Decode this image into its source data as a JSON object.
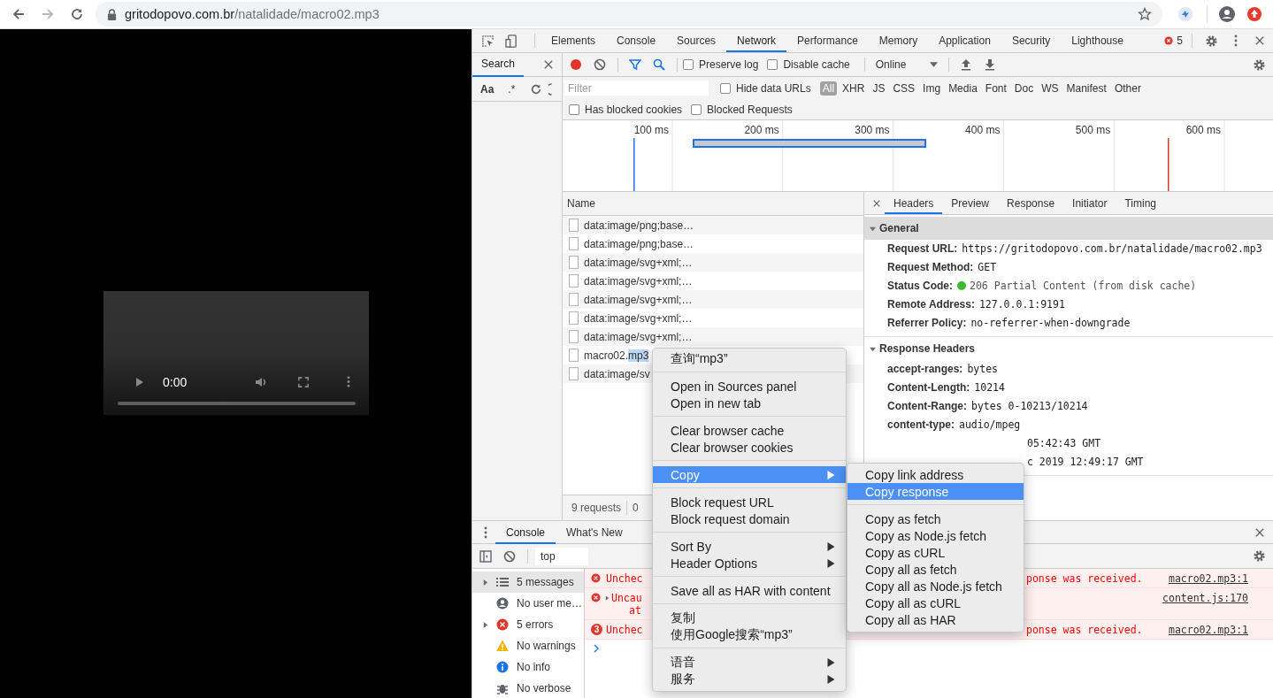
{
  "browser": {
    "url_host": "gritodopovo.com.br",
    "url_path": "/natalidade/macro02.mp3"
  },
  "player": {
    "time": "0:00"
  },
  "devtools": {
    "tabs": [
      {
        "label": "Elements",
        "selected": false
      },
      {
        "label": "Console",
        "selected": false
      },
      {
        "label": "Sources",
        "selected": false
      },
      {
        "label": "Network",
        "selected": true
      },
      {
        "label": "Performance",
        "selected": false
      },
      {
        "label": "Memory",
        "selected": false
      },
      {
        "label": "Application",
        "selected": false
      },
      {
        "label": "Security",
        "selected": false
      },
      {
        "label": "Lighthouse",
        "selected": false
      }
    ],
    "error_count": "5",
    "search_panel": {
      "tab": "Search",
      "options": [
        "Aa",
        ".*"
      ]
    },
    "toolbar": {
      "recording": true,
      "checkboxes": [
        {
          "label": "Preserve log",
          "checked": false
        },
        {
          "label": "Disable cache",
          "checked": false
        }
      ],
      "throttling": "Online"
    },
    "filter": {
      "placeholder": "Filter",
      "hide_data_urls": {
        "label": "Hide data URLs",
        "checked": false
      },
      "types": [
        {
          "label": "All",
          "selected": true
        },
        {
          "label": "XHR",
          "selected": false
        },
        {
          "label": "JS",
          "selected": false
        },
        {
          "label": "CSS",
          "selected": false
        },
        {
          "label": "Img",
          "selected": false
        },
        {
          "label": "Media",
          "selected": false
        },
        {
          "label": "Font",
          "selected": false
        },
        {
          "label": "Doc",
          "selected": false
        },
        {
          "label": "WS",
          "selected": false
        },
        {
          "label": "Manifest",
          "selected": false
        },
        {
          "label": "Other",
          "selected": false
        }
      ],
      "extra": [
        {
          "label": "Has blocked cookies",
          "checked": false
        },
        {
          "label": "Blocked Requests",
          "checked": false
        }
      ]
    },
    "overview": {
      "ticks": [
        "100 ms",
        "200 ms",
        "300 ms",
        "400 ms",
        "500 ms",
        "600 ms"
      ]
    },
    "requests": {
      "column": "Name",
      "rows": [
        {
          "name": "data:image/png;base…"
        },
        {
          "name": "data:image/png;base…"
        },
        {
          "name": "data:image/svg+xml;…"
        },
        {
          "name": "data:image/svg+xml;…"
        },
        {
          "name": "data:image/svg+xml;…"
        },
        {
          "name": "data:image/svg+xml;…"
        },
        {
          "name": "data:image/svg+xml;…"
        },
        {
          "name": "macro02.",
          "highlight": "mp3"
        },
        {
          "name": "data:image/sv"
        }
      ],
      "status": [
        "9 requests",
        "0"
      ]
    },
    "detail_tabs": [
      {
        "label": "Headers",
        "selected": true
      },
      {
        "label": "Preview",
        "selected": false
      },
      {
        "label": "Response",
        "selected": false
      },
      {
        "label": "Initiator",
        "selected": false
      },
      {
        "label": "Timing",
        "selected": false
      }
    ],
    "sections": [
      {
        "title": "General",
        "expanded": true,
        "rows": [
          {
            "kind": "pair",
            "key": "Request URL:",
            "value": "https://gritodopovo.com.br/natalidade/macro02.mp3"
          },
          {
            "kind": "pair",
            "key": "Request Method:",
            "value": "GET"
          },
          {
            "kind": "pair",
            "key": "Status Code:",
            "value": "206 Partial Content (from disk cache)",
            "color": "#3cba2e"
          },
          {
            "kind": "pair",
            "key": "Remote Address:",
            "value": "127.0.0.1:9191"
          },
          {
            "kind": "pair",
            "key": "Referrer Policy:",
            "value": "no-referrer-when-downgrade"
          }
        ]
      },
      {
        "title": "Response Headers",
        "expanded": true,
        "rows": [
          {
            "kind": "pair",
            "key": "accept-ranges:",
            "value": "bytes"
          },
          {
            "kind": "pair",
            "key": "Content-Length:",
            "value": "10214"
          },
          {
            "kind": "pair",
            "key": "Content-Range:",
            "value": "bytes 0-10213/10214"
          },
          {
            "kind": "pair",
            "key": "content-type:",
            "value": "audio/mpeg"
          },
          {
            "kind": "fragment",
            "value": "05:42:43 GMT"
          },
          {
            "kind": "fragment",
            "value": "c 2019 12:49:17 GMT"
          }
        ]
      }
    ],
    "drawer": {
      "tabs": [
        {
          "label": "Console",
          "selected": true
        },
        {
          "label": "What's New",
          "selected": false
        }
      ],
      "context": "top",
      "sidebar": [
        {
          "kind": "messages",
          "label": "5 messages",
          "expandable": true,
          "selected": true
        },
        {
          "kind": "user",
          "label": "No user me…",
          "expandable": false,
          "selected": false
        },
        {
          "kind": "errors",
          "label": "5 errors",
          "expandable": true,
          "selected": false
        },
        {
          "kind": "warnings",
          "label": "No warnings",
          "expandable": false,
          "selected": false
        },
        {
          "kind": "info",
          "label": "No info",
          "expandable": false,
          "selected": false
        },
        {
          "kind": "verbose",
          "label": "No verbose",
          "expandable": false,
          "selected": false
        }
      ],
      "messages": [
        {
          "kind": "error",
          "start": "Unchec",
          "end": "ponse was received.",
          "source": "macro02.mp3:1"
        },
        {
          "kind": "uncaught",
          "start": "Uncau",
          "second": "at",
          "source": "content.js:170"
        },
        {
          "kind": "repeat",
          "count": "3",
          "start": "Unchec",
          "end": "ponse was received.",
          "source": "macro02.mp3:1"
        }
      ]
    }
  },
  "context_menu": {
    "groups": [
      [
        {
          "label": "查询“mp3”",
          "submenu": false,
          "selected": false
        }
      ],
      [
        {
          "label": "Open in Sources panel",
          "submenu": false,
          "selected": false
        },
        {
          "label": "Open in new tab",
          "submenu": false,
          "selected": false
        }
      ],
      [
        {
          "label": "Clear browser cache",
          "submenu": false,
          "selected": false
        },
        {
          "label": "Clear browser cookies",
          "submenu": false,
          "selected": false
        }
      ],
      [
        {
          "label": "Copy",
          "submenu": true,
          "selected": true
        }
      ],
      [
        {
          "label": "Block request URL",
          "submenu": false,
          "selected": false
        },
        {
          "label": "Block request domain",
          "submenu": false,
          "selected": false
        }
      ],
      [
        {
          "label": "Sort By",
          "submenu": true,
          "selected": false
        },
        {
          "label": "Header Options",
          "submenu": true,
          "selected": false
        }
      ],
      [
        {
          "label": "Save all as HAR with content",
          "submenu": false,
          "selected": false
        }
      ],
      [
        {
          "label": "复制",
          "submenu": false,
          "selected": false
        },
        {
          "label": "使用Google搜索“mp3”",
          "submenu": false,
          "selected": false
        }
      ],
      [
        {
          "label": "语音",
          "submenu": true,
          "selected": false
        },
        {
          "label": "服务",
          "submenu": true,
          "selected": false
        }
      ]
    ]
  },
  "submenu": {
    "groups": [
      [
        {
          "label": "Copy link address",
          "selected": false
        },
        {
          "label": "Copy response",
          "selected": true
        }
      ],
      [
        {
          "label": "Copy as fetch",
          "selected": false
        },
        {
          "label": "Copy as Node.js fetch",
          "selected": false
        },
        {
          "label": "Copy as cURL",
          "selected": false
        },
        {
          "label": "Copy all as fetch",
          "selected": false
        },
        {
          "label": "Copy all as Node.js fetch",
          "selected": false
        },
        {
          "label": "Copy all as cURL",
          "selected": false
        },
        {
          "label": "Copy all as HAR",
          "selected": false
        }
      ]
    ]
  }
}
